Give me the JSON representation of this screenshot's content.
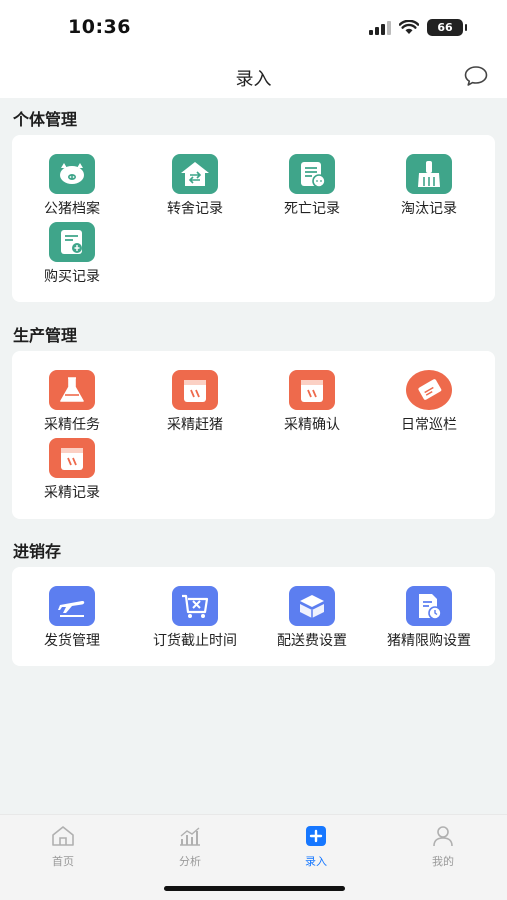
{
  "status": {
    "time": "10:36",
    "battery": "66"
  },
  "header": {
    "title": "录入"
  },
  "sections": [
    {
      "title": "个体管理",
      "color": "#3fa58a",
      "items": [
        {
          "label": "公猪档案",
          "icon": "boar-profile-icon"
        },
        {
          "label": "转舍记录",
          "icon": "transfer-house-icon"
        },
        {
          "label": "死亡记录",
          "icon": "death-record-icon"
        },
        {
          "label": "淘汰记录",
          "icon": "cull-record-icon"
        },
        {
          "label": "购买记录",
          "icon": "purchase-record-icon"
        }
      ]
    },
    {
      "title": "生产管理",
      "color": "#ee6a4c",
      "items": [
        {
          "label": "采精任务",
          "icon": "collection-task-icon"
        },
        {
          "label": "采精赶猪",
          "icon": "collection-drive-icon"
        },
        {
          "label": "采精确认",
          "icon": "collection-confirm-icon"
        },
        {
          "label": "日常巡栏",
          "icon": "daily-inspection-icon"
        },
        {
          "label": "采精记录",
          "icon": "collection-record-icon"
        }
      ]
    },
    {
      "title": "进销存",
      "color": "#5c7ef0",
      "items": [
        {
          "label": "发货管理",
          "icon": "shipping-icon"
        },
        {
          "label": "订货截止时间",
          "icon": "order-deadline-icon"
        },
        {
          "label": "配送费设置",
          "icon": "delivery-fee-icon"
        },
        {
          "label": "猪精限购设置",
          "icon": "purchase-limit-icon"
        }
      ]
    }
  ],
  "tabs": [
    {
      "label": "首页",
      "icon": "home-icon",
      "active": false
    },
    {
      "label": "分析",
      "icon": "analysis-icon",
      "active": false
    },
    {
      "label": "录入",
      "icon": "entry-plus-icon",
      "active": true
    },
    {
      "label": "我的",
      "icon": "profile-icon",
      "active": false
    }
  ],
  "colors": {
    "accent": "#1677ff",
    "inactive": "#9a9a9a",
    "background": "#f0f3f3"
  }
}
